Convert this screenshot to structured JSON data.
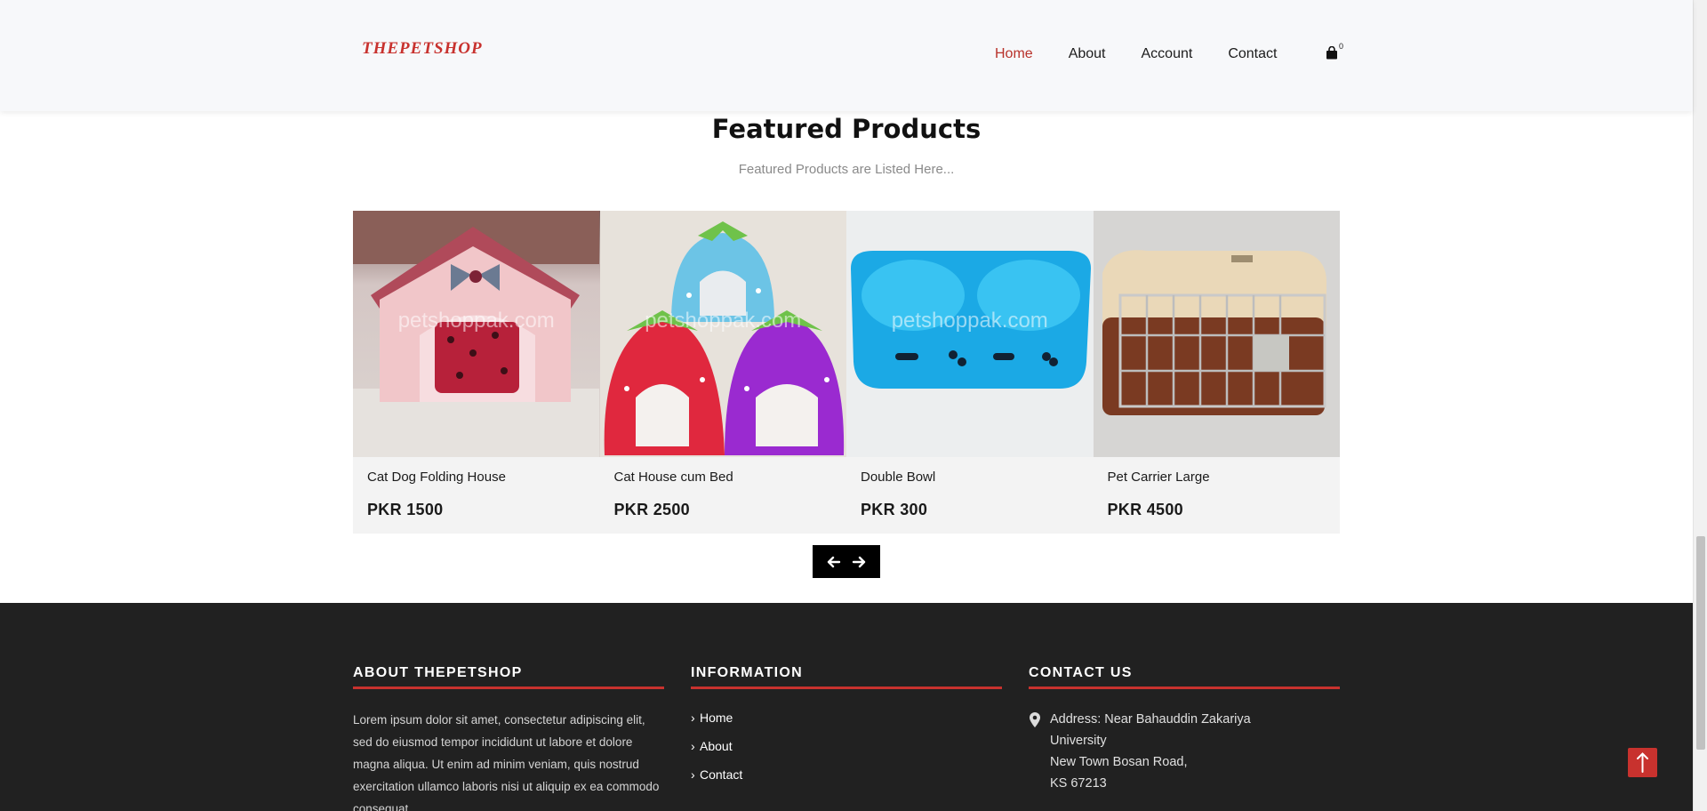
{
  "header": {
    "logo": "THEPETSHOP",
    "nav": [
      "Home",
      "About",
      "Account",
      "Contact"
    ],
    "active_nav": "Home",
    "cart_count": "0"
  },
  "featured": {
    "title": "Featured Products",
    "subtitle": "Featured Products are Listed Here...",
    "products": [
      {
        "name": "Cat Dog Folding House",
        "price": "PKR 1500",
        "watermark": "petshoppak.com"
      },
      {
        "name": "Cat House cum Bed",
        "price": "PKR 2500",
        "watermark": "petshoppak.com"
      },
      {
        "name": "Double Bowl",
        "price": "PKR 300",
        "watermark": "petshoppak.com"
      },
      {
        "name": "Pet Carrier Large",
        "price": "PKR 4500",
        "watermark": ""
      }
    ]
  },
  "footer": {
    "about": {
      "heading": "ABOUT THEPETSHOP",
      "text": "Lorem ipsum dolor sit amet, consectetur adipiscing elit, sed do eiusmod tempor incididunt ut labore et dolore magna aliqua. Ut enim ad minim veniam, quis nostrud exercitation ullamco laboris nisi ut aliquip ex ea commodo consequat."
    },
    "information": {
      "heading": "INFORMATION",
      "links": [
        "Home",
        "About",
        "Contact"
      ]
    },
    "contact": {
      "heading": "CONTACT US",
      "address_lines": [
        "Address: Near Bahauddin Zakariya",
        "University",
        "New Town Bosan Road,",
        "KS 67213"
      ]
    }
  },
  "colors": {
    "accent": "#c8322e",
    "footer_bg": "#212121",
    "header_bg": "#f7f8fa"
  }
}
